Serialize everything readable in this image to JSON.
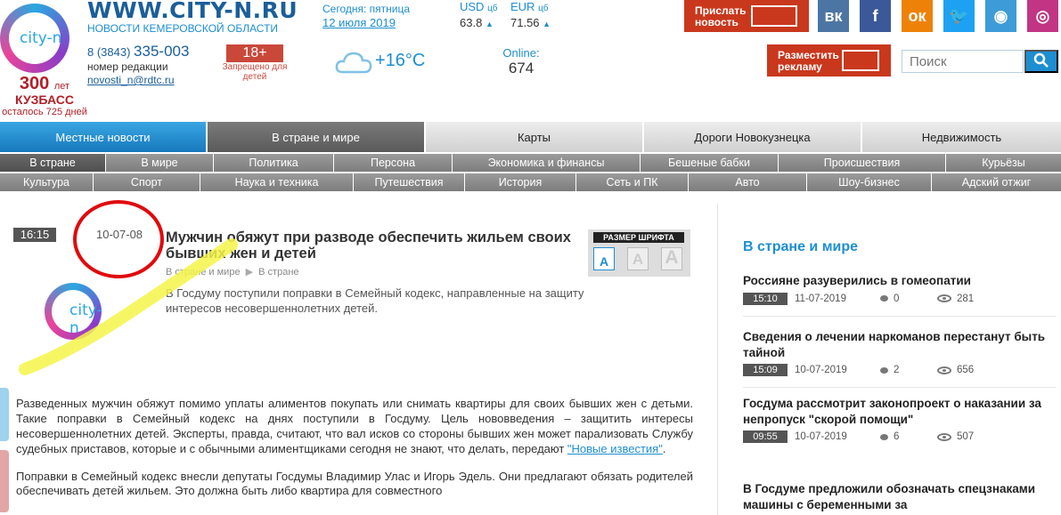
{
  "header": {
    "logo_text": "city-n",
    "anniversary_number": "300",
    "anniversary_unit": "лет",
    "anniversary_region": "КУЗБАСС",
    "anniversary_left": "осталось 725 дней",
    "site_title": "WWW.CITY-N.RU",
    "site_subtitle": "НОВОСТИ КЕМЕРОВСКОЙ ОБЛАСТИ",
    "phone_prefix": "8 (3843)",
    "phone_number": "335-003",
    "phone_label": "номер редакции",
    "email": "novosti_n@rdtc.ru",
    "today_label": "Сегодня: пятница",
    "today_date": "12 июля 2019",
    "currencies": [
      {
        "code": "USD",
        "suffix": "цб",
        "value": "63.8",
        "trend": "▲"
      },
      {
        "code": "EUR",
        "suffix": "цб",
        "value": "71.56",
        "trend": "▲"
      }
    ],
    "age_rating": "18+",
    "age_label": "Запрещено для детей",
    "weather_icon": "cloud-icon",
    "temperature": "+16°C",
    "online_label": "Online:",
    "online_value": "674",
    "send_news_label_1": "Прислать",
    "send_news_label_2": "новость",
    "advertise_label_1": "Разместить",
    "advertise_label_2": "рекламу",
    "search_placeholder": "Поиск",
    "social": [
      {
        "name": "vk-icon",
        "glyph": "вк",
        "color": "#4c75a3"
      },
      {
        "name": "facebook-icon",
        "glyph": "f",
        "color": "#3b5998"
      },
      {
        "name": "odnoklassniki-icon",
        "glyph": "ок",
        "color": "#ee8208"
      },
      {
        "name": "twitter-icon",
        "glyph": "🐦",
        "color": "#1da1f2"
      },
      {
        "name": "rss-icon",
        "glyph": "◉",
        "color": "#3d9bd8"
      },
      {
        "name": "instagram-icon",
        "glyph": "◎",
        "color": "#c13584"
      }
    ]
  },
  "nav_main": [
    {
      "label": "Местные новости",
      "bg": "#1c8bd0",
      "color": "#fff"
    },
    {
      "label": "В стране и мире",
      "bg": "#6a6a6a",
      "color": "#fff"
    },
    {
      "label": "Карты",
      "bg": "#cfcfcf",
      "color": "#222"
    },
    {
      "label": "Дороги Новокузнецка",
      "bg": "#cfcfcf",
      "color": "#222"
    },
    {
      "label": "Недвижимость",
      "bg": "#cfcfcf",
      "color": "#222"
    }
  ],
  "nav_sub1": [
    "В стране",
    "В мире",
    "Политика",
    "Персона",
    "Экономика и финансы",
    "Бешеные бабки",
    "Происшествия",
    "Курьёзы"
  ],
  "nav_sub2": [
    "Культура",
    "Спорт",
    "Наука и техника",
    "Путешествия",
    "История",
    "Сеть и ПК",
    "Авто",
    "Шоу-бизнес",
    "Адский отжиг"
  ],
  "article": {
    "time": "16:15",
    "date": "10-07-08",
    "title": "Мужчин обяжут при разводе обеспечить жильем своих бывших жен и детей",
    "crumb_1": "В стране и мире",
    "crumb_sep": "▶",
    "crumb_2": "В стране",
    "lead": "В Госдуму поступили поправки в Семейный кодекс, направленные на защиту интересов несовершеннолетних детей.",
    "font_size_label": "РАЗМЕР ШРИФТА",
    "font_sizes": [
      "A",
      "A",
      "A"
    ],
    "logo_text": "city-n",
    "p1": "Разведенных мужчин обяжут помимо уплаты алиментов покупать или снимать квартиры для своих бывших жен с детьми. Такие поправки в Семейный кодекс на днях поступили в Госдуму. Цель нововведения – защитить интересы несовершеннолетних детей. Эксперты, правда, считают, что вал исков со стороны бывших жен может парализовать Службу судебных приставов, которые и с обычными алиментщиками сегодня не знают, что делать, передают ",
    "p1_link": "\"Новые известия\"",
    "p1_end": ".",
    "p2": "Поправки в Семейный кодекс внесли депутаты Госдумы Владимир Улас и Игорь Эдель. Они предлагают обязать родителей обеспечивать детей жильем. Это должна быть либо квартира для совместного"
  },
  "sidebar": {
    "title": "В стране и мире",
    "items": [
      {
        "title": "Россияне разуверились в гомеопатии",
        "time": "15:10",
        "date": "11-07-2019",
        "comments": "0",
        "views": "281"
      },
      {
        "title": "Сведения о лечении наркоманов перестанут быть тайной",
        "time": "15:09",
        "date": "10-07-2019",
        "comments": "2",
        "views": "656"
      },
      {
        "title": "Госдума рассмотрит законопроект о наказании за непропуск \"скорой помощи\"",
        "time": "09:55",
        "date": "10-07-2019",
        "comments": "6",
        "views": "507"
      },
      {
        "title": "В Госдуме предложили обозначать спецзнаками машины с беременными за"
      }
    ]
  }
}
